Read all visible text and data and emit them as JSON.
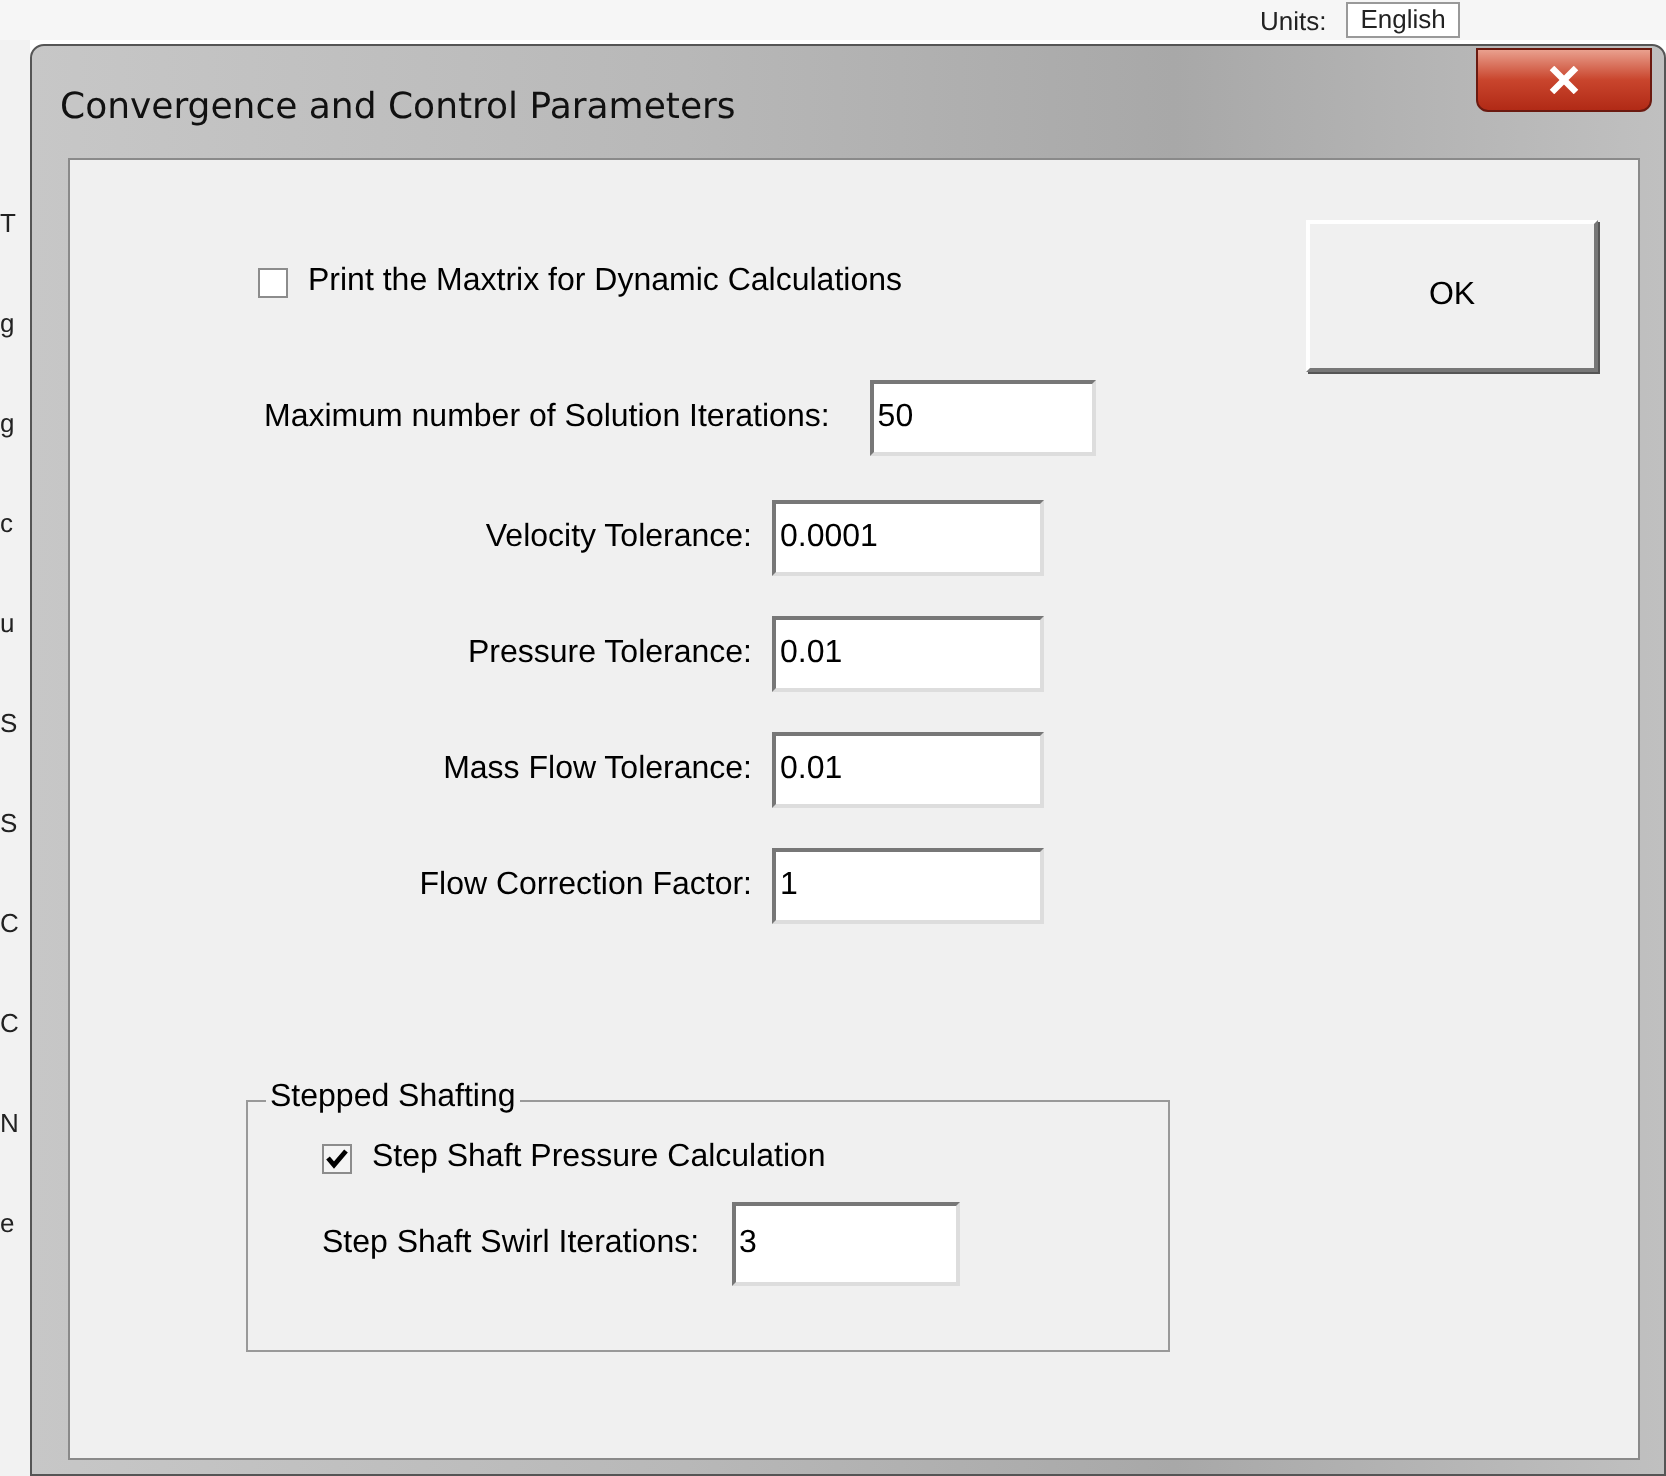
{
  "background": {
    "units_label": "Units:",
    "units_value": "English",
    "edge_letters": [
      "T",
      "g",
      "g",
      "c",
      "u",
      "S",
      "S",
      "C",
      "C",
      "N",
      "e"
    ]
  },
  "window": {
    "title": "Convergence and Control Parameters"
  },
  "print_matrix": {
    "label": "Print the Maxtrix for Dynamic Calculations",
    "checked": false
  },
  "ok_button": "OK",
  "max_iterations": {
    "label": "Maximum number of Solution Iterations:",
    "value": "50"
  },
  "tolerances": [
    {
      "label": "Velocity Tolerance:",
      "value": "0.0001"
    },
    {
      "label": "Pressure Tolerance:",
      "value": "0.01"
    },
    {
      "label": "Mass Flow Tolerance:",
      "value": "0.01"
    },
    {
      "label": "Flow Correction Factor:",
      "value": "1"
    }
  ],
  "stepped_shafting": {
    "title": "Stepped Shafting",
    "pressure_calc": {
      "label": "Step Shaft Pressure Calculation",
      "checked": true
    },
    "swirl_iterations": {
      "label": "Step Shaft Swirl Iterations:",
      "value": "3"
    }
  }
}
